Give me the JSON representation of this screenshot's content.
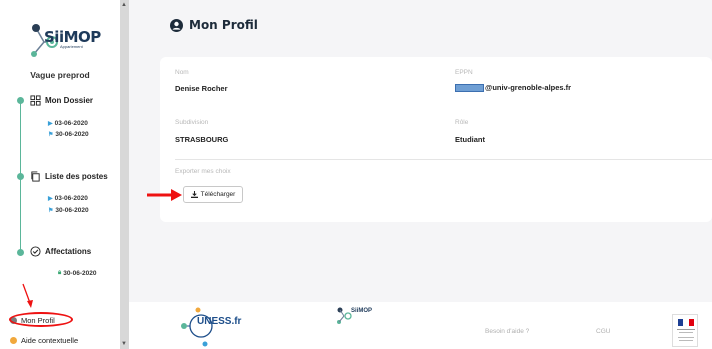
{
  "sidebar": {
    "logo_text": "SiiMOP",
    "logo_sub": "Appariement",
    "wave_title": "Vague preprod",
    "timeline": [
      {
        "label": "Mon Dossier",
        "start": "03-06-2020",
        "end": "30-06-2020"
      },
      {
        "label": "Liste des postes",
        "start": "03-06-2020",
        "end": "30-06-2020"
      },
      {
        "label": "Affectations",
        "date": "30-06-2020"
      }
    ],
    "nav": {
      "profile": "Mon Profil",
      "help": "Aide contextuelle"
    }
  },
  "main": {
    "page_title": "Mon Profil",
    "fields": {
      "nom_label": "Nom",
      "nom_value": "Denise Rocher",
      "eppn_label": "EPPN",
      "eppn_value": "@univ-grenoble-alpes.fr",
      "subdivision_label": "Subdivision",
      "subdivision_value": "STRASBOURG",
      "role_label": "Rôle",
      "role_value": "Etudiant"
    },
    "export_label": "Exporter mes choix",
    "download_button": "Télécharger"
  },
  "footer": {
    "uness": "UNESS.fr",
    "siimop": "SiiMOP",
    "help": "Besoin d'aide ?",
    "cgu": "CGU"
  },
  "colors": {
    "accent_green": "#5bb69a",
    "title_navy": "#1d2b3a",
    "annotation_red": "#e11111",
    "redaction_blue": "#6f9fd4"
  }
}
